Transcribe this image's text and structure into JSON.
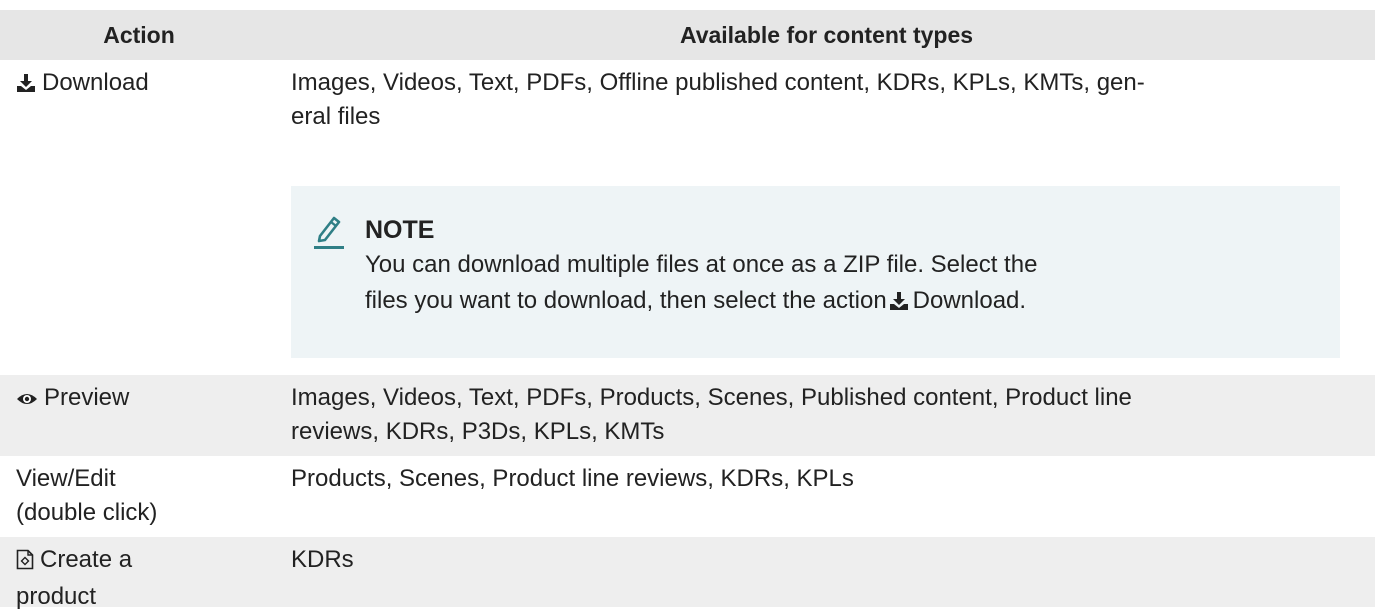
{
  "table": {
    "header": {
      "action": "Action",
      "types": "Available for content types"
    },
    "rows": [
      {
        "action_icon": "download-icon",
        "action_label": "Download",
        "types_line1": "Images, Videos, Text, PDFs, Offline published content, KDRs, KPLs, KMTs, gen-",
        "types_line2": "eral files",
        "note": {
          "icon": "pencil-icon",
          "title": "NOTE",
          "body_line1": "You can download multiple files at once as a ZIP file. Select the",
          "body_line2_pre": "files you want to download, then select the action",
          "body_line2_action": "Download."
        }
      },
      {
        "action_icon": "eye-icon",
        "action_label": "Preview",
        "types_line1": "Images, Videos, Text, PDFs, Products, Scenes, Published content, Product line",
        "types_line2": "reviews, KDRs, P3Ds, KPLs, KMTs"
      },
      {
        "action_label_line1": "View/Edit",
        "action_label_line2": "(double click)",
        "types_line1": "Products, Scenes, Product line reviews, KDRs, KPLs"
      },
      {
        "action_icon": "create-product-icon",
        "action_label_line1": "Create a",
        "action_label_line2": "product",
        "types_line1": "KDRs"
      }
    ]
  },
  "colors": {
    "header_bg": "#e6e6e6",
    "shaded_row_bg": "#eeeeee",
    "note_bg": "#eef4f6",
    "note_icon": "#2f7f86",
    "text": "#222222"
  }
}
